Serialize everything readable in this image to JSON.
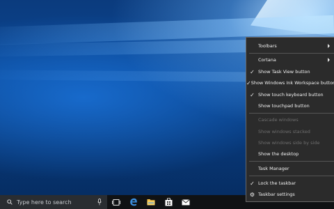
{
  "desktop": {
    "wallpaper": "windows-10-hero"
  },
  "taskbar": {
    "search_placeholder": "Type here to search",
    "icons": [
      "task-view-icon",
      "edge-icon",
      "file-explorer-icon",
      "store-icon",
      "mail-icon"
    ]
  },
  "menu": {
    "toolbars": "Toolbars",
    "cortana": "Cortana",
    "show_task_view": "Show Task View button",
    "show_ink": "Show Windows Ink Workspace button",
    "show_keyboard": "Show touch keyboard button",
    "show_touchpad": "Show touchpad button",
    "cascade": "Cascade windows",
    "stacked": "Show windows stacked",
    "side_by_side": "Show windows side by side",
    "show_desktop": "Show the desktop",
    "task_manager": "Task Manager",
    "lock_taskbar": "Lock the taskbar",
    "taskbar_settings": "Taskbar settings"
  },
  "colors": {
    "menu_bg": "#2b2b2b",
    "taskbar_bg": "#101214",
    "disabled_text": "#6e6e6e",
    "edge_blue": "#3b8fe0"
  }
}
